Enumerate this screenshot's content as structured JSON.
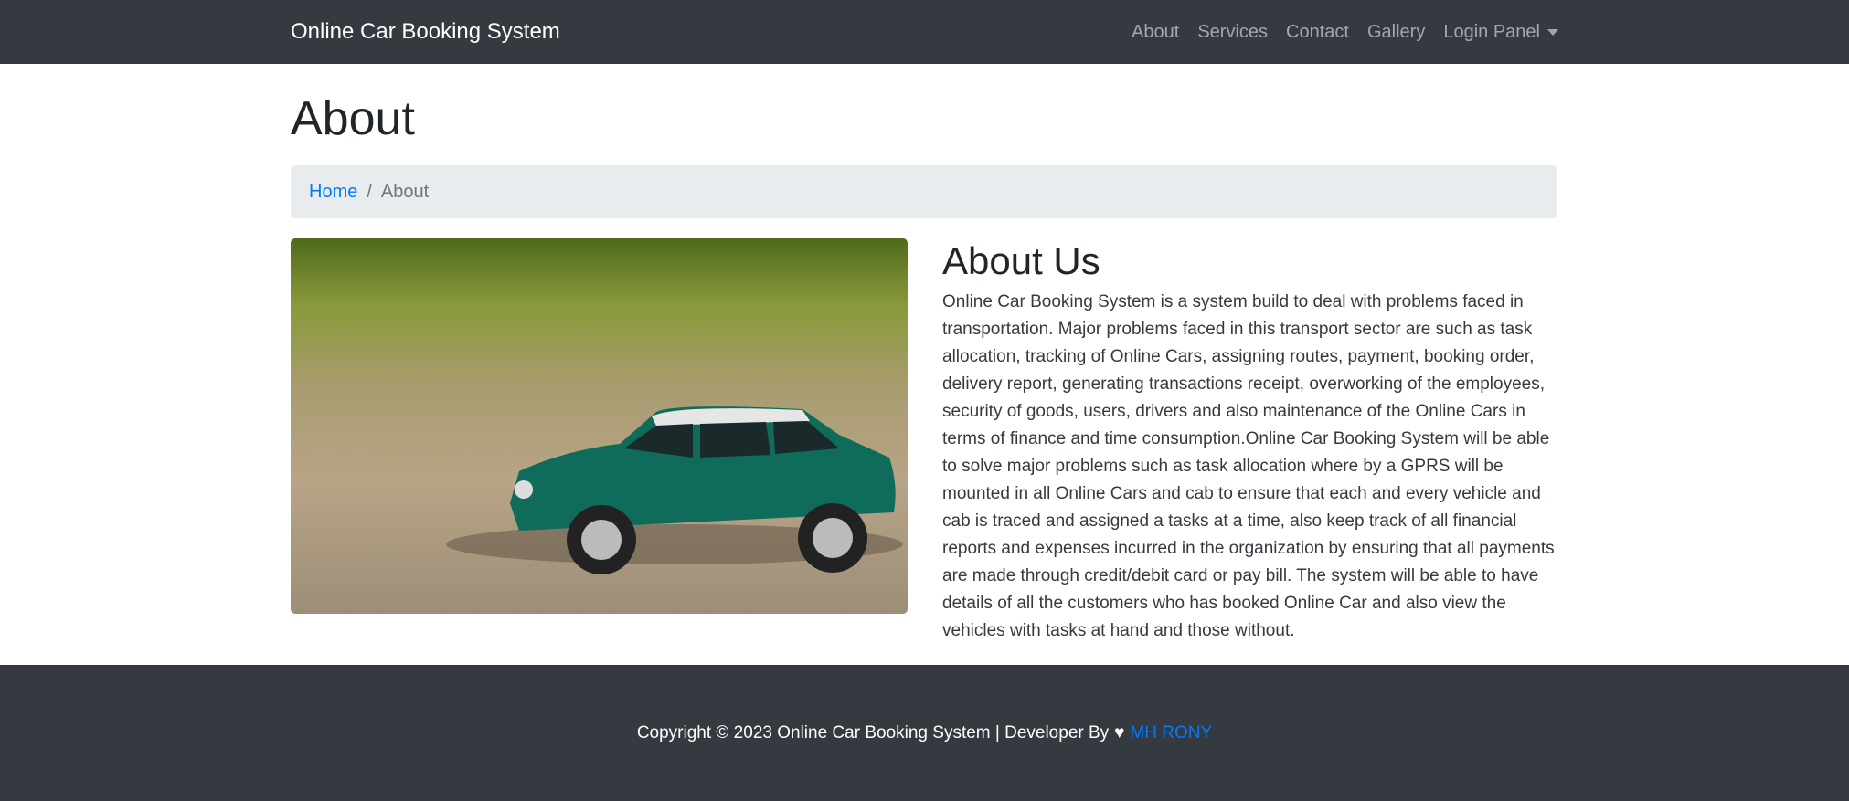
{
  "navbar": {
    "brand": "Online Car Booking System",
    "links": [
      "About",
      "Services",
      "Contact",
      "Gallery",
      "Login Panel"
    ]
  },
  "page": {
    "title": "About"
  },
  "breadcrumb": {
    "home": "Home",
    "separator": "/",
    "current": "About"
  },
  "about": {
    "heading": "About Us",
    "body": "Online Car Booking System is a system build to deal with problems faced in transportation. Major problems faced in this transport sector are such as task allocation, tracking of Online Cars, assigning routes, payment, booking order, delivery report, generating transactions receipt, overworking of the employees, security of goods, users, drivers and also maintenance of the Online Cars in terms of finance and time consumption.Online Car Booking System will be able to solve major problems such as task allocation where by a GPRS will be mounted in all Online Cars and cab to ensure that each and every vehicle and cab is traced and assigned a tasks at a time, also keep track of all financial reports and expenses incurred in the organization by ensuring that all payments are made through credit/debit card or pay bill. The system will be able to have details of all the customers who has booked Online Car and also view the vehicles with tasks at hand and those without."
  },
  "footer": {
    "text": "Copyright © 2023 Online Car Booking System | Developer By",
    "heart_icon": "heart-pulse-icon",
    "author": "MH RONY"
  },
  "colors": {
    "navbar": "#343a40",
    "link": "#007bff",
    "breadcrumb_bg": "#e9ecef"
  }
}
